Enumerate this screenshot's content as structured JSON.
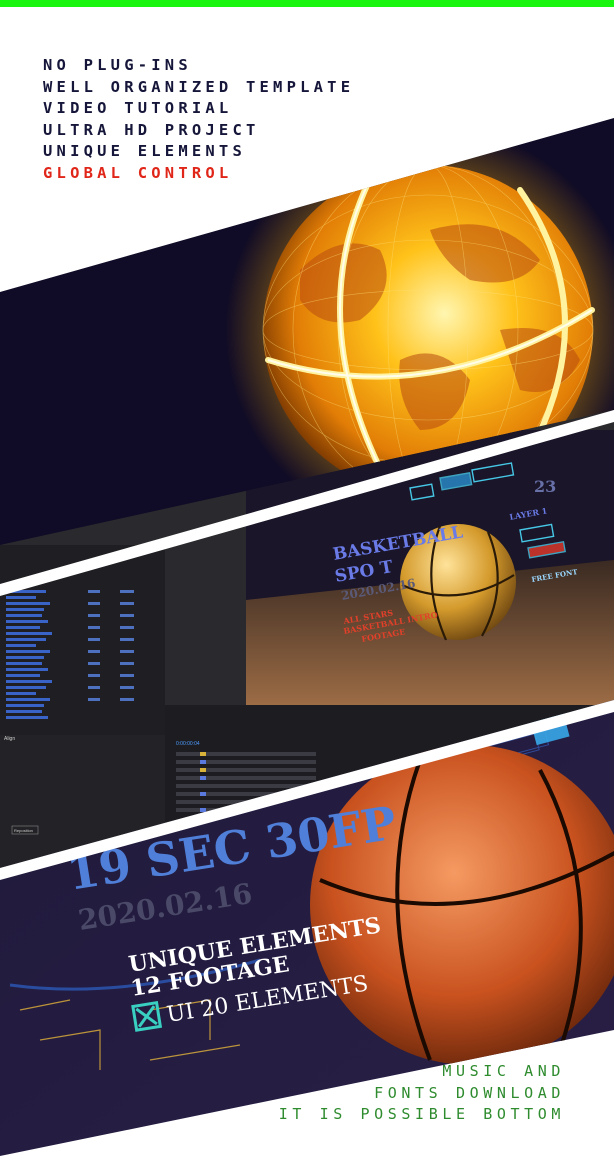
{
  "features": [
    {
      "label": "NO PLUG-INS",
      "accent": false
    },
    {
      "label": "WELL ORGANIZED TEMPLATE",
      "accent": false
    },
    {
      "label": "VIDEO TUTORIAL",
      "accent": false
    },
    {
      "label": "ULTRA HD PROJECT",
      "accent": false
    },
    {
      "label": "UNIQUE ELEMENTS",
      "accent": false
    },
    {
      "label": "GLOBAL CONTROL",
      "accent": true
    }
  ],
  "panel2": {
    "scene_title_line1": "BASKETBALL",
    "scene_title_line2": "SPO  T",
    "scene_date": "2020.02.16",
    "scene_tag1": "ALL STARS",
    "scene_tag2": "BASKETBALL INTRO",
    "scene_tag3": "FOOTAGE",
    "scene_num": "23",
    "scene_layer": "LAYER 1",
    "scene_font": "FREE FONT",
    "timecode": "0:00:00:04",
    "align_label": "Align",
    "reposition_label": "Reposition"
  },
  "panel3": {
    "headline": "19 SEC 30FP",
    "date": "2020.02.16",
    "line1": "UNIQUE ELEMENTS",
    "line2": "12 FOOTAGE",
    "line3": "UI 20 ELEMENTS"
  },
  "bottom_text": [
    "MUSIC AND",
    "FONTS DOWNLOAD",
    "IT IS POSSIBLE BOTTOM"
  ],
  "colors": {
    "top_bar": "#19f50f",
    "feature_text": "#16163a",
    "accent": "#e02619",
    "bottom_text": "#2e8b2e"
  }
}
